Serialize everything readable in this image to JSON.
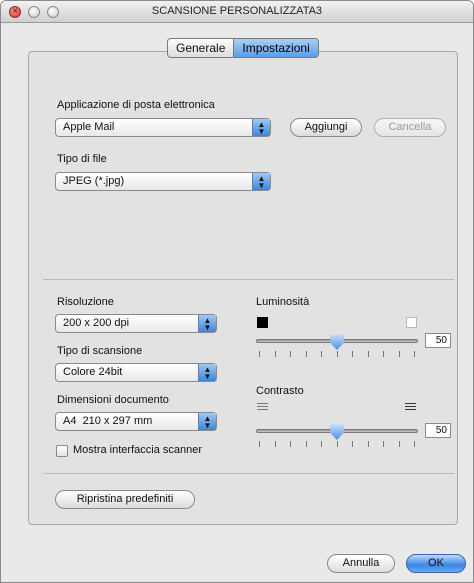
{
  "window": {
    "title": "SCANSIONE PERSONALIZZATA3"
  },
  "tabs": [
    {
      "label": "Generale"
    },
    {
      "label": "Impostazioni"
    }
  ],
  "email": {
    "label": "Applicazione di posta elettronica",
    "selected": "Apple Mail",
    "add_label": "Aggiungi",
    "delete_label": "Cancella"
  },
  "filetype": {
    "label": "Tipo di file",
    "selected": "JPEG (*.jpg)"
  },
  "resolution": {
    "label": "Risoluzione",
    "selected": "200 x 200 dpi"
  },
  "scan_type": {
    "label": "Tipo di scansione",
    "selected": "Colore 24bit"
  },
  "doc_size": {
    "label": "Dimensioni documento",
    "selected": "A4  210 x 297 mm"
  },
  "show_interface": {
    "label": "Mostra interfaccia scanner",
    "checked": false
  },
  "brightness": {
    "label": "Luminosità",
    "value": "50"
  },
  "contrast": {
    "label": "Contrasto",
    "value": "50"
  },
  "reset_label": "Ripristina predefiniti",
  "footer": {
    "cancel_label": "Annulla",
    "ok_label": "OK"
  },
  "icons": {
    "close": "close-icon",
    "minimize": "minimize-icon",
    "zoom": "zoom-icon",
    "popup_arrows": "updown-arrows-icon"
  },
  "colors": {
    "accent": "#5b9de8",
    "window_bg": "#e9e9e9",
    "panel_bg": "#e2e2e2"
  }
}
